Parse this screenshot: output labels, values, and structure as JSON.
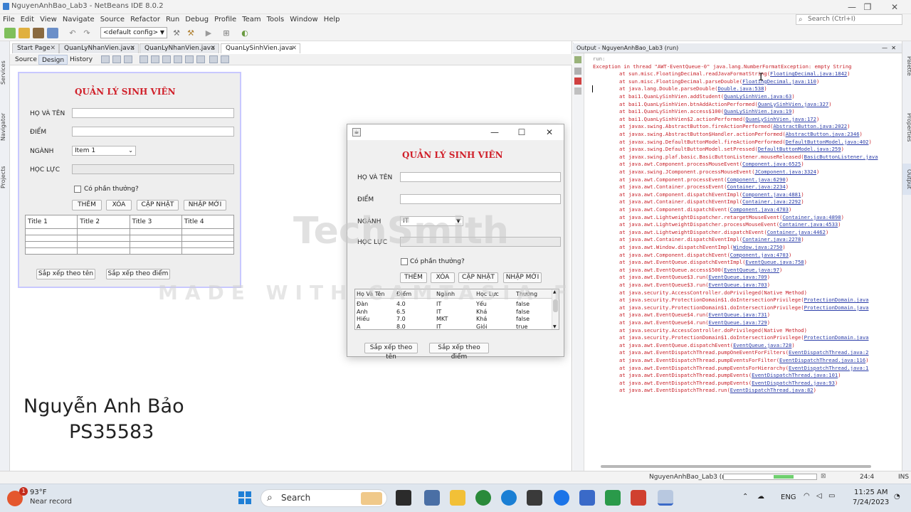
{
  "window": {
    "title": "NguyenAnhBao_Lab3 - NetBeans IDE 8.0.2",
    "min_glyph": "—",
    "max_glyph": "❐",
    "close_glyph": "✕"
  },
  "menu": [
    "File",
    "Edit",
    "View",
    "Navigate",
    "Source",
    "Refactor",
    "Run",
    "Debug",
    "Profile",
    "Team",
    "Tools",
    "Window",
    "Help"
  ],
  "search": {
    "placeholder": "Search (Ctrl+I)"
  },
  "toolbar": {
    "config": "<default config>"
  },
  "left_tabs": [
    "Services",
    "Navigator",
    "Projects"
  ],
  "right_tabs": [
    "Palette",
    "Properties",
    "Output"
  ],
  "editor_tabs": [
    {
      "label": "Start Page"
    },
    {
      "label": "QuanLyNhanVien.java"
    },
    {
      "label": "QuanLyNhanVien.java"
    },
    {
      "label": "QuanLySinhVien.java"
    }
  ],
  "sub_tabs": [
    "Source",
    "Design",
    "History"
  ],
  "design_form": {
    "title": "QUẢN LÝ SINH VIÊN",
    "label_name": "HỌ VÀ TÊN",
    "label_score": "ĐIỂM",
    "label_major": "NGÀNH",
    "label_rank": "HỌC LỰC",
    "major_value": "Item 1",
    "reward_label": "Có phần thưởng?",
    "btn_add": "THÊM",
    "btn_delete": "XÓA",
    "btn_update": "CẬP NHẬT",
    "btn_new": "NHẬP MỚI",
    "columns": [
      "Title 1",
      "Title 2",
      "Title 3",
      "Title 4"
    ],
    "btn_sort_name": "Sắp xếp theo tên",
    "btn_sort_score": "Sắp xếp theo điểm"
  },
  "author": {
    "name": "Nguyễn Anh Bảo",
    "id": "PS35583"
  },
  "dialog": {
    "title": "QUẢN LÝ SINH VIÊN",
    "label_name": "HỌ VÀ TÊN",
    "label_score": "ĐIỂM",
    "label_major": "NGÀNH",
    "label_rank": "HỌC LỰC",
    "major_value": "IT",
    "reward_label": "Có phần thưởng?",
    "btn_add": "THÊM",
    "btn_delete": "XÓA",
    "btn_update": "CẬP NHẬT",
    "btn_new": "NHẬP MỚI",
    "columns": [
      "Họ Và Tên",
      "Điểm",
      "Ngành",
      "Học Lực",
      "Thưởng"
    ],
    "rows": [
      [
        "Đàn",
        "4.0",
        "IT",
        "Yếu",
        "false"
      ],
      [
        "Anh",
        "6.5",
        "IT",
        "Khá",
        "false"
      ],
      [
        "Hiếu",
        "7.0",
        "MKT",
        "Khá",
        "false"
      ],
      [
        "A",
        "8.0",
        "IT",
        "Giỏi",
        "true"
      ]
    ],
    "btn_sort_name": "Sắp xếp theo tên",
    "btn_sort_score": "Sắp xếp theo điểm"
  },
  "watermark": {
    "line1": "TechSmith",
    "line2": "MADE WITH CAMTASIA FREE"
  },
  "output": {
    "header": "Output - NguyenAnhBao_Lab3 (run)",
    "lines": [
      {
        "text": "run:",
        "link": "",
        "tail": "",
        "indent": 0,
        "gray": true
      },
      {
        "text": "Exception in thread \"AWT-EventQueue-0\" java.lang.NumberFormatException: empty String",
        "link": "",
        "tail": "",
        "indent": 0
      },
      {
        "text": "at sun.misc.FloatingDecimal.readJavaFormatString(",
        "link": "FloatingDecimal.java:1842",
        "tail": ")",
        "indent": 1
      },
      {
        "text": "at sun.misc.FloatingDecimal.parseDouble(",
        "link": "FloatingDecimal.java:110",
        "tail": ")",
        "indent": 1
      },
      {
        "text": "at java.lang.Double.parseDouble(",
        "link": "Double.java:538",
        "tail": ")",
        "indent": 1
      },
      {
        "text": "at bai1.QuanLySinhVien.addStudent(",
        "link": "QuanLySinhVien.java:63",
        "tail": ")",
        "indent": 1
      },
      {
        "text": "at bai1.QuanLySinhVien.btnAddActionPerformed(",
        "link": "QuanLySinhVien.java:327",
        "tail": ")",
        "indent": 1
      },
      {
        "text": "at bai1.QuanLySinhVien.access$100(",
        "link": "QuanLySinhVien.java:19",
        "tail": ")",
        "indent": 1
      },
      {
        "text": "at bai1.QuanLySinhVien$2.actionPerformed(",
        "link": "QuanLySinhVien.java:172",
        "tail": ")",
        "indent": 1
      },
      {
        "text": "at javax.swing.AbstractButton.fireActionPerformed(",
        "link": "AbstractButton.java:2022",
        "tail": ")",
        "indent": 1
      },
      {
        "text": "at javax.swing.AbstractButton$Handler.actionPerformed(",
        "link": "AbstractButton.java:2346",
        "tail": ")",
        "indent": 1
      },
      {
        "text": "at javax.swing.DefaultButtonModel.fireActionPerformed(",
        "link": "DefaultButtonModel.java:402",
        "tail": ")",
        "indent": 1
      },
      {
        "text": "at javax.swing.DefaultButtonModel.setPressed(",
        "link": "DefaultButtonModel.java:259",
        "tail": ")",
        "indent": 1
      },
      {
        "text": "at javax.swing.plaf.basic.BasicButtonListener.mouseReleased(",
        "link": "BasicButtonListener.java",
        "tail": "",
        "indent": 1
      },
      {
        "text": "at java.awt.Component.processMouseEvent(",
        "link": "Component.java:6525",
        "tail": ")",
        "indent": 1
      },
      {
        "text": "at javax.swing.JComponent.processMouseEvent(",
        "link": "JComponent.java:3324",
        "tail": ")",
        "indent": 1
      },
      {
        "text": "at java.awt.Component.processEvent(",
        "link": "Component.java:6290",
        "tail": ")",
        "indent": 1
      },
      {
        "text": "at java.awt.Container.processEvent(",
        "link": "Container.java:2234",
        "tail": ")",
        "indent": 1
      },
      {
        "text": "at java.awt.Component.dispatchEventImpl(",
        "link": "Component.java:4881",
        "tail": ")",
        "indent": 1
      },
      {
        "text": "at java.awt.Container.dispatchEventImpl(",
        "link": "Container.java:2292",
        "tail": ")",
        "indent": 1
      },
      {
        "text": "at java.awt.Component.dispatchEvent(",
        "link": "Component.java:4703",
        "tail": ")",
        "indent": 1
      },
      {
        "text": "at java.awt.LightweightDispatcher.retargetMouseEvent(",
        "link": "Container.java:4898",
        "tail": ")",
        "indent": 1
      },
      {
        "text": "at java.awt.LightweightDispatcher.processMouseEvent(",
        "link": "Container.java:4533",
        "tail": ")",
        "indent": 1
      },
      {
        "text": "at java.awt.LightweightDispatcher.dispatchEvent(",
        "link": "Container.java:4462",
        "tail": ")",
        "indent": 1
      },
      {
        "text": "at java.awt.Container.dispatchEventImpl(",
        "link": "Container.java:2278",
        "tail": ")",
        "indent": 1
      },
      {
        "text": "at java.awt.Window.dispatchEventImpl(",
        "link": "Window.java:2750",
        "tail": ")",
        "indent": 1
      },
      {
        "text": "at java.awt.Component.dispatchEvent(",
        "link": "Component.java:4703",
        "tail": ")",
        "indent": 1
      },
      {
        "text": "at java.awt.EventQueue.dispatchEventImpl(",
        "link": "EventQueue.java:758",
        "tail": ")",
        "indent": 1
      },
      {
        "text": "at java.awt.EventQueue.access$500(",
        "link": "EventQueue.java:97",
        "tail": ")",
        "indent": 1
      },
      {
        "text": "at java.awt.EventQueue$3.run(",
        "link": "EventQueue.java:709",
        "tail": ")",
        "indent": 1
      },
      {
        "text": "at java.awt.EventQueue$3.run(",
        "link": "EventQueue.java:703",
        "tail": ")",
        "indent": 1
      },
      {
        "text": "at java.security.AccessController.doPrivileged(Native Method)",
        "link": "",
        "tail": "",
        "indent": 1
      },
      {
        "text": "at java.security.ProtectionDomain$1.doIntersectionPrivilege(",
        "link": "ProtectionDomain.java",
        "tail": "",
        "indent": 1
      },
      {
        "text": "at java.security.ProtectionDomain$1.doIntersectionPrivilege(",
        "link": "ProtectionDomain.java",
        "tail": "",
        "indent": 1
      },
      {
        "text": "at java.awt.EventQueue$4.run(",
        "link": "EventQueue.java:731",
        "tail": ")",
        "indent": 1
      },
      {
        "text": "at java.awt.EventQueue$4.run(",
        "link": "EventQueue.java:729",
        "tail": ")",
        "indent": 1
      },
      {
        "text": "at java.security.AccessController.doPrivileged(Native Method)",
        "link": "",
        "tail": "",
        "indent": 1
      },
      {
        "text": "at java.security.ProtectionDomain$1.doIntersectionPrivilege(",
        "link": "ProtectionDomain.java",
        "tail": "",
        "indent": 1
      },
      {
        "text": "at java.awt.EventQueue.dispatchEvent(",
        "link": "EventQueue.java:728",
        "tail": ")",
        "indent": 1
      },
      {
        "text": "at java.awt.EventDispatchThread.pumpOneEventForFilters(",
        "link": "EventDispatchThread.java:2",
        "tail": "",
        "indent": 1
      },
      {
        "text": "at java.awt.EventDispatchThread.pumpEventsForFilter(",
        "link": "EventDispatchThread.java:116",
        "tail": ")",
        "indent": 1
      },
      {
        "text": "at java.awt.EventDispatchThread.pumpEventsForHierarchy(",
        "link": "EventDispatchThread.java:1",
        "tail": "",
        "indent": 1
      },
      {
        "text": "at java.awt.EventDispatchThread.pumpEvents(",
        "link": "EventDispatchThread.java:101",
        "tail": ")",
        "indent": 1
      },
      {
        "text": "at java.awt.EventDispatchThread.pumpEvents(",
        "link": "EventDispatchThread.java:93",
        "tail": ")",
        "indent": 1
      },
      {
        "text": "at java.awt.EventDispatchThread.run(",
        "link": "EventDispatchThread.java:82",
        "tail": ")",
        "indent": 1
      }
    ]
  },
  "status": {
    "run_label": "NguyenAnhBao_Lab3 (run)",
    "position": "24:4",
    "mode": "INS",
    "progress_fraction": 0.21
  },
  "taskbar": {
    "weather_temp": "93°F",
    "weather_desc": "Near record",
    "weather_badge": "1",
    "search_label": "Search",
    "lang": "ENG",
    "time": "11:25 AM",
    "date": "7/24/2023"
  },
  "colors": {
    "form_title": "#d0202a",
    "output_error": "#c8222a",
    "output_link": "#2a3ca8",
    "taskbar": "#dfe6ee"
  }
}
